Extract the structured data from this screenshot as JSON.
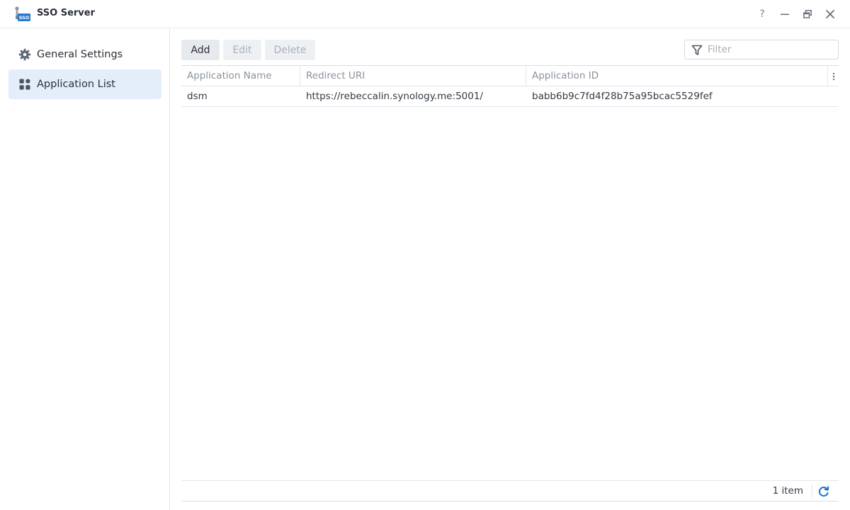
{
  "window": {
    "title": "SSO Server",
    "help_label": "?",
    "app_icon_badge": "SSO"
  },
  "sidebar": {
    "items": [
      {
        "label": "General Settings",
        "icon": "gear-icon",
        "active": false
      },
      {
        "label": "Application List",
        "icon": "grid-icon",
        "active": true
      }
    ]
  },
  "toolbar": {
    "add_label": "Add",
    "edit_label": "Edit",
    "delete_label": "Delete",
    "filter_placeholder": "Filter"
  },
  "grid": {
    "columns": [
      "Application Name",
      "Redirect URI",
      "Application ID"
    ],
    "rows": [
      {
        "name": "dsm",
        "redirect_uri": "https://rebeccalin.synology.me:5001/",
        "app_id": "babb6b9c7fd4f28b75a95bcac5529fef"
      }
    ]
  },
  "footer": {
    "count_label": "1 item"
  },
  "colors": {
    "accent": "#1a73c8",
    "active_nav_bg": "#e3eefa"
  }
}
